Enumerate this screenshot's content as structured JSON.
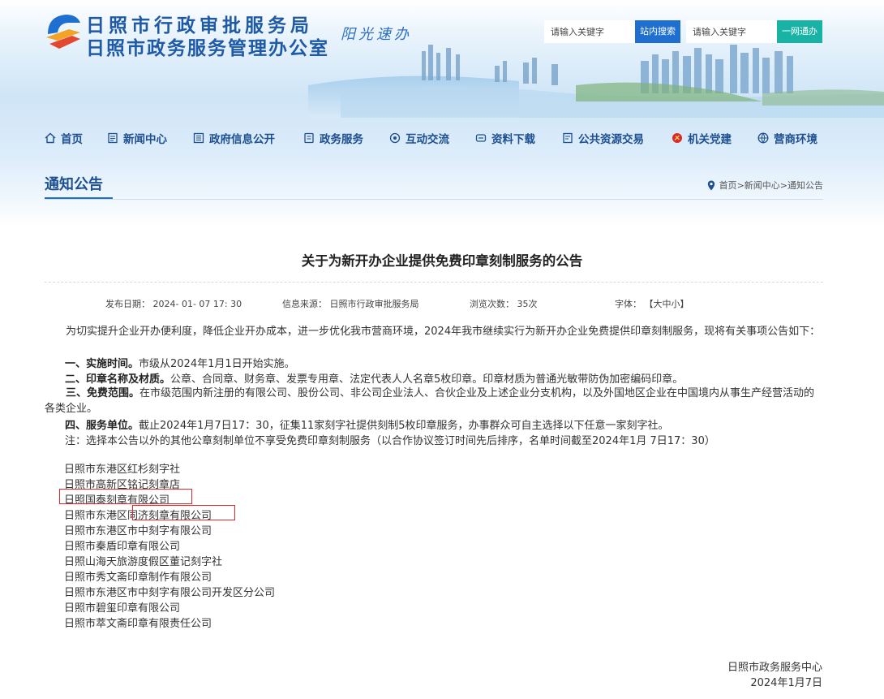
{
  "header": {
    "title_line1": "日照市行政审批服务局",
    "title_line2": "日照市政务服务管理办公室",
    "slogan": "阳光速办",
    "search1": {
      "placeholder": "请输入关键字",
      "button": "站内搜索"
    },
    "search2": {
      "placeholder": "请输入关键字",
      "button": "一网通办"
    }
  },
  "nav": [
    {
      "label": "首页",
      "icon": "home-icon"
    },
    {
      "label": "新闻中心",
      "icon": "news-icon"
    },
    {
      "label": "政府信息公开",
      "icon": "info-icon"
    },
    {
      "label": "政务服务",
      "icon": "service-icon"
    },
    {
      "label": "互动交流",
      "icon": "chat-icon"
    },
    {
      "label": "资料下载",
      "icon": "download-icon"
    },
    {
      "label": "公共资源交易",
      "icon": "trade-icon"
    },
    {
      "label": "机关党建",
      "icon": "party-icon"
    },
    {
      "label": "营商环境",
      "icon": "globe-icon"
    }
  ],
  "section": {
    "title": "通知公告",
    "breadcrumb": [
      "首页",
      "新闻中心",
      "通知公告"
    ],
    "breadcrumb_sep": ">"
  },
  "article": {
    "title": "关于为新开办企业提供免费印章刻制服务的公告",
    "meta": {
      "date_label": "发布日期：",
      "date": "2024- 01- 07 17: 30",
      "source_label": "信息来源：",
      "source": "日照市行政审批服务局",
      "views_label": "浏览次数：",
      "views": "35次",
      "font_label": "字体：",
      "font_sizes": "【大中小】"
    },
    "intro": "为切实提升企业开办便利度，降低企业开办成本，进一步优化我市营商环境，2024年我市继续实行为新开办企业免费提供印章刻制服务，现将有关事项公告如下：",
    "items": [
      {
        "head": "一、实施时间。",
        "text": "市级从2024年1月1日开始实施。"
      },
      {
        "head": "二、印章名称及材质。",
        "text": "公章、合同章、财务章、发票专用章、法定代表人人名章5枚印章。印章材质为普通光敏带防伪加密编码印章。"
      },
      {
        "head": "三、免费范围。",
        "text": "在市级范围内新注册的有限公司、股份公司、非公司企业法人、合伙企业及上述企业分支机构，以及外国地区企业在中国境内从事生产经营活动的各类企业。"
      },
      {
        "head": "四、服务单位。",
        "text": "截止2024年1月7日17：30，征集11家刻字社提供刻制5枚印章服务，办事群众可自主选择以下任意一家刻字社。"
      }
    ],
    "note": "注：选择本公告以外的其他公章刻制单位不享受免费印章刻制服务（以合作协议签订时间先后排序，名单时间截至2024年1月 7日17：30）",
    "companies": [
      "日照市东港区红杉刻字社",
      "日照市高新区铭记刻章店",
      "日照国泰刻章有限公司",
      "日照市东港区同济刻章有限公司",
      "日照市东港区市中刻字有限公司",
      "日照市秦盾印章有限公司",
      "日照山海天旅游度假区董记刻字社",
      "日照市秀文斋印章制作有限公司",
      "日照市东港区市中刻字有限公司开发区分公司",
      "日照市碧玺印章有限公司",
      "日照市萃文斋印章有限责任公司"
    ],
    "signature": {
      "org": "日照市政务服务中心",
      "date": "2024年1月7日"
    }
  },
  "colors": {
    "brand_blue": "#1d4f91",
    "search_blue": "#1f6fd1",
    "teal": "#18b3a4",
    "highlight_red": "#e0292b"
  }
}
